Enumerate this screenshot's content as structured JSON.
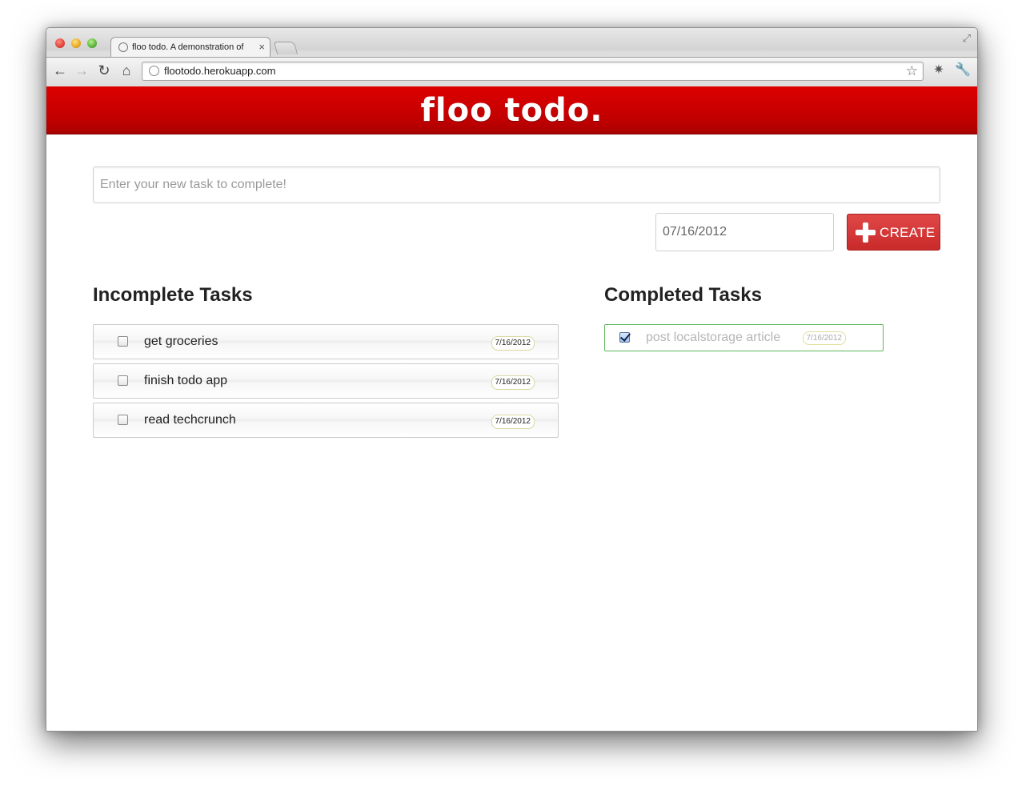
{
  "browser": {
    "tab_title": "floo todo. A demonstration of",
    "tab_close_glyph": "×",
    "url": "flootodo.herokuapp.com",
    "back_glyph": "←",
    "forward_glyph": "→",
    "reload_glyph": "↻",
    "home_glyph": "⌂",
    "star_glyph": "☆",
    "resize_glyph": "⤢",
    "extension_glyph": "✷",
    "wrench_glyph": "🔧",
    "icons": [
      "close-window",
      "minimize-window",
      "zoom-window",
      "globe-icon",
      "back-icon",
      "forward-icon",
      "reload-icon",
      "home-icon",
      "bookmark-star-icon",
      "extension-icon",
      "wrench-icon",
      "fullscreen-icon"
    ]
  },
  "header": {
    "logo": "floo todo.",
    "color": "#cc0000"
  },
  "form": {
    "task_placeholder": "Enter your new task to complete!",
    "date_value": "07/16/2012",
    "create_label": "CREATE",
    "create_color": "#d43636"
  },
  "incomplete": {
    "title": "Incomplete Tasks",
    "items": [
      {
        "text": "get groceries",
        "date": "7/16/2012"
      },
      {
        "text": "finish todo app",
        "date": "7/16/2012"
      },
      {
        "text": "read techcrunch",
        "date": "7/16/2012"
      }
    ]
  },
  "completed": {
    "title": "Completed Tasks",
    "border_color": "#5bb75b",
    "items": [
      {
        "text": "post localstorage article",
        "date": "7/16/2012"
      }
    ]
  }
}
